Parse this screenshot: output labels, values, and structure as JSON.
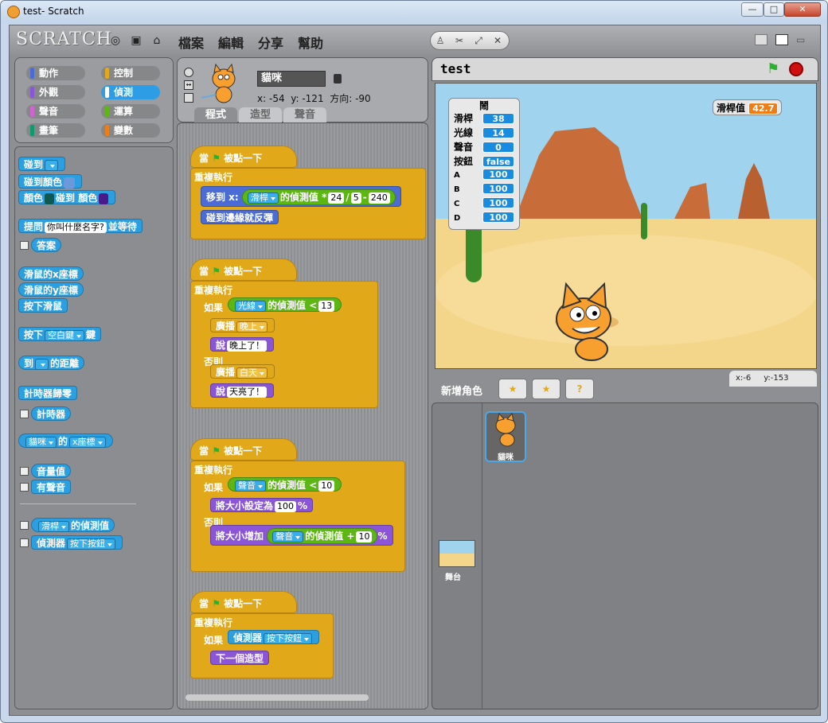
{
  "window": {
    "title": "test- Scratch",
    "min": "—",
    "max": "□",
    "close": "✕"
  },
  "menubar": {
    "logo": "SCRATCH",
    "file": "檔案",
    "edit": "編輯",
    "share": "分享",
    "help": "幫助"
  },
  "categories": {
    "motion": "動作",
    "control": "控制",
    "looks": "外觀",
    "sensing": "偵測",
    "sound": "聲音",
    "operators": "運算",
    "pen": "畫筆",
    "variables": "變數"
  },
  "palette": {
    "touching": "碰到",
    "touching_color": "碰到顏色",
    "color": "顏色",
    "touching2": "碰到",
    "color2": "顏色",
    "ask": "提問",
    "ask_default": "你叫什麼名字?",
    "ask_wait": "並等待",
    "answer": "答案",
    "mouse_x": "滑鼠的x座標",
    "mouse_y": "滑鼠的y座標",
    "mouse_down": "按下滑鼠",
    "key": "按下",
    "key_default": "空白鍵",
    "key2": "鍵",
    "distance": "到",
    "distance2": "的距離",
    "reset_timer": "計時器歸零",
    "timer": "計時器",
    "of_target": "貓咪",
    "of_word": "的",
    "of_attr": "x座標",
    "loudness": "音量值",
    "loud": "有聲音",
    "sensor_value_dd": "滑桿",
    "sensor_value": "的偵測值",
    "sensor": "偵測器",
    "sensor_dd": "按下按鈕"
  },
  "sprite": {
    "name": "貓咪",
    "x_label": "x:",
    "x": "-54",
    "y_label": "y:",
    "y": "-121",
    "dir_label": "方向:",
    "dir": "-90"
  },
  "tabs": {
    "scripts": "程式",
    "costumes": "造型",
    "sounds": "聲音"
  },
  "scripts": {
    "when_flag": "當",
    "clicked": "被點一下",
    "forever": "重複執行",
    "goto_x": "移到 x:",
    "slider": "滑桿",
    "sensor_value": "的偵測值",
    "mul": "*",
    "n24": "24",
    "div": "/",
    "n5": "5",
    "minus": "-",
    "n240": "240",
    "bounce": "碰到邊緣就反彈",
    "if": "如果",
    "else": "否則",
    "light": "光線",
    "lt": "<",
    "n13": "13",
    "broadcast": "廣播",
    "night": "晚上",
    "say": "說",
    "night_msg": "晚上了！",
    "day": "白天",
    "day_msg": "天亮了！",
    "sound": "聲音",
    "n10": "10",
    "set_size": "將大小設定為",
    "n100": "100",
    "pct": "%",
    "change_size": "將大小增加",
    "plus": "+",
    "n10b": "10",
    "sensor": "偵測器",
    "button": "按下按鈕",
    "next_costume": "下一個造型"
  },
  "stage": {
    "title": "test",
    "slider_label": "滑桿值",
    "slider_val": "42.7",
    "board_title": "鬧",
    "board": [
      {
        "k": "滑桿",
        "v": "38"
      },
      {
        "k": "光線",
        "v": "14"
      },
      {
        "k": "聲音",
        "v": "0"
      },
      {
        "k": "按鈕",
        "v": "false"
      },
      {
        "k": "A",
        "v": "100"
      },
      {
        "k": "B",
        "v": "100"
      },
      {
        "k": "C",
        "v": "100"
      },
      {
        "k": "D",
        "v": "100"
      }
    ]
  },
  "coords": {
    "x_label": "x:",
    "x": "-6",
    "y_label": "y:",
    "y": "-153"
  },
  "sprites": {
    "new_sprite": "新增角色",
    "cat": "貓咪",
    "stage": "舞台"
  }
}
